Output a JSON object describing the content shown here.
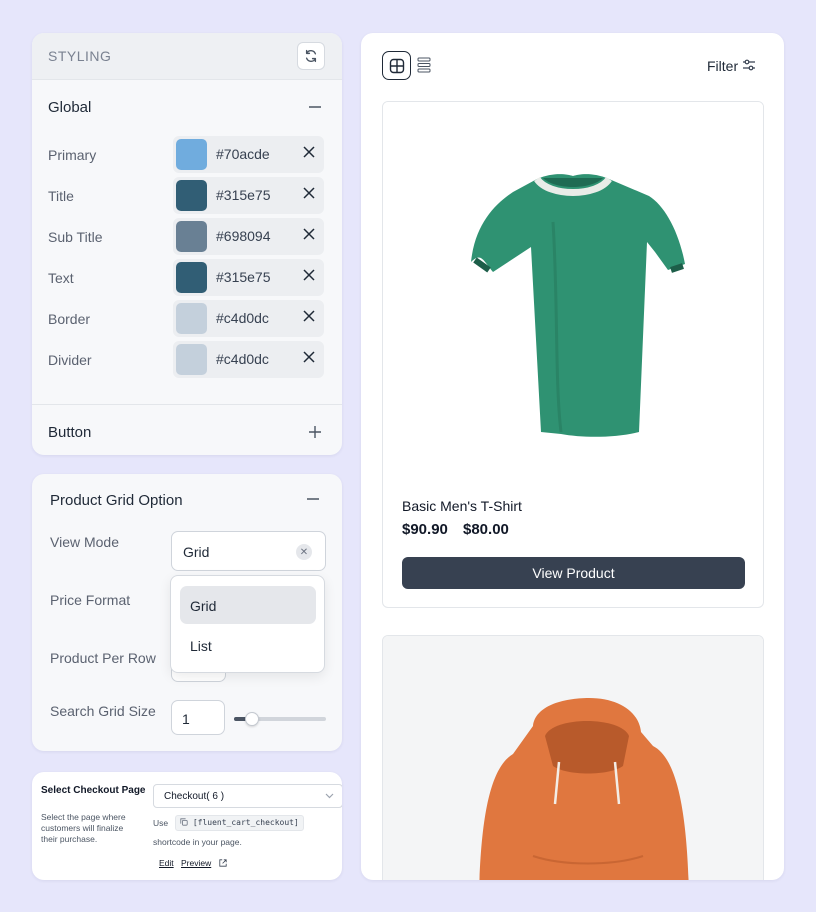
{
  "styling": {
    "header_label": "STYLING",
    "global_title": "Global",
    "colors": [
      {
        "name": "Primary",
        "hex": "#70acde",
        "swatch": "#70acde"
      },
      {
        "name": "Title",
        "hex": "#315e75",
        "swatch": "#315e75"
      },
      {
        "name": "Sub Title",
        "hex": "#698094",
        "swatch": "#698094"
      },
      {
        "name": "Text",
        "hex": "#315e75",
        "swatch": "#315e75"
      },
      {
        "name": "Border",
        "hex": "#c4d0dc",
        "swatch": "#c4d0dc"
      },
      {
        "name": "Divider",
        "hex": "#c4d0dc",
        "swatch": "#c4d0dc"
      }
    ],
    "button_section": "Button"
  },
  "grid_option": {
    "title": "Product Grid Option",
    "view_mode_label": "View Mode",
    "view_mode_value": "Grid",
    "price_format_label": "Price Format",
    "per_row_label": "Product Per Row",
    "search_size_label": "Search Grid Size",
    "search_size_value": "1",
    "slider_fraction": 0.2,
    "dropdown_options": [
      "Grid",
      "List"
    ]
  },
  "checkout": {
    "title": "Select Checkout Page",
    "description": "Select the page where customers will finalize their purchase.",
    "selected": "Checkout( 6 )",
    "use_label": "Use",
    "shortcode": "[fluent_cart_checkout]",
    "shortcode_hint": "shortcode in your page.",
    "edit_link": "Edit",
    "preview_link": "Preview"
  },
  "products": {
    "filter_label": "Filter",
    "items": [
      {
        "name": "Basic Men's T-Shirt",
        "original_price": "$90.90",
        "sale_price": "$80.00",
        "button": "View Product"
      }
    ]
  },
  "colors": {
    "tshirt": "#2f9272",
    "hoodie": "#e0773f",
    "button_dark": "#374151"
  }
}
